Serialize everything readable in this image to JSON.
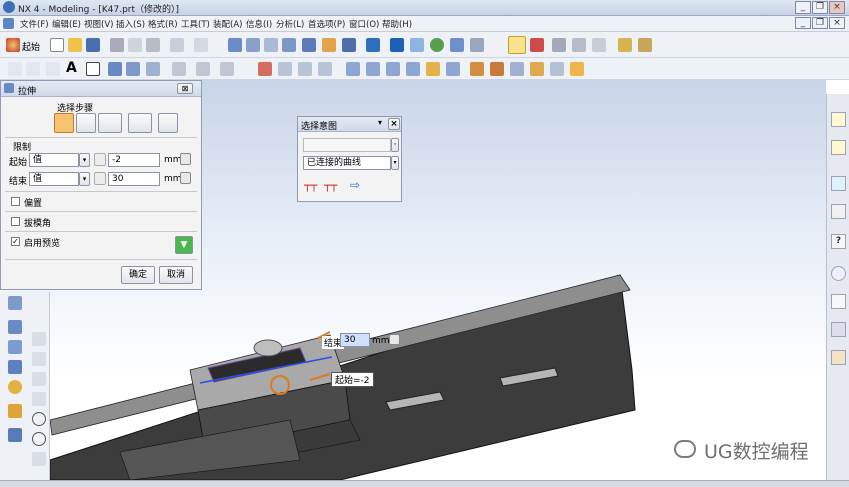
{
  "window": {
    "title": "NX 4 - Modeling - [K47.prt（修改的）]",
    "controls": [
      "_",
      "❐",
      "×"
    ],
    "inner_controls": [
      "_",
      "❐",
      "×"
    ]
  },
  "menu": [
    "文件(F)",
    "编辑(E)",
    "视图(V)",
    "插入(S)",
    "格式(R)",
    "工具(T)",
    "装配(A)",
    "信息(I)",
    "分析(L)",
    "首选项(P)",
    "窗口(O)",
    "帮助(H)"
  ],
  "toolbar": {
    "start_label": "起始"
  },
  "extrude_dialog": {
    "title": "拉伸",
    "section_select_steps": "选择步骤",
    "section_limits": "限制",
    "start_label": "起始",
    "start_type": "值",
    "start_value": "-2",
    "end_label": "结束",
    "end_type": "值",
    "end_value": "30",
    "unit": "mm",
    "offset_label": "偏置",
    "draft_label": "拔模角",
    "preview_label": "启用预览",
    "ok_label": "确定",
    "cancel_label": "取消"
  },
  "select_intent": {
    "title": "选择意图",
    "option_top": "",
    "option_curve": "已连接的曲线"
  },
  "handles": {
    "end_label": "结束",
    "end_value": "30",
    "unit": "mm",
    "start_tag": "起始=-2"
  },
  "watermark": "UG数控编程"
}
